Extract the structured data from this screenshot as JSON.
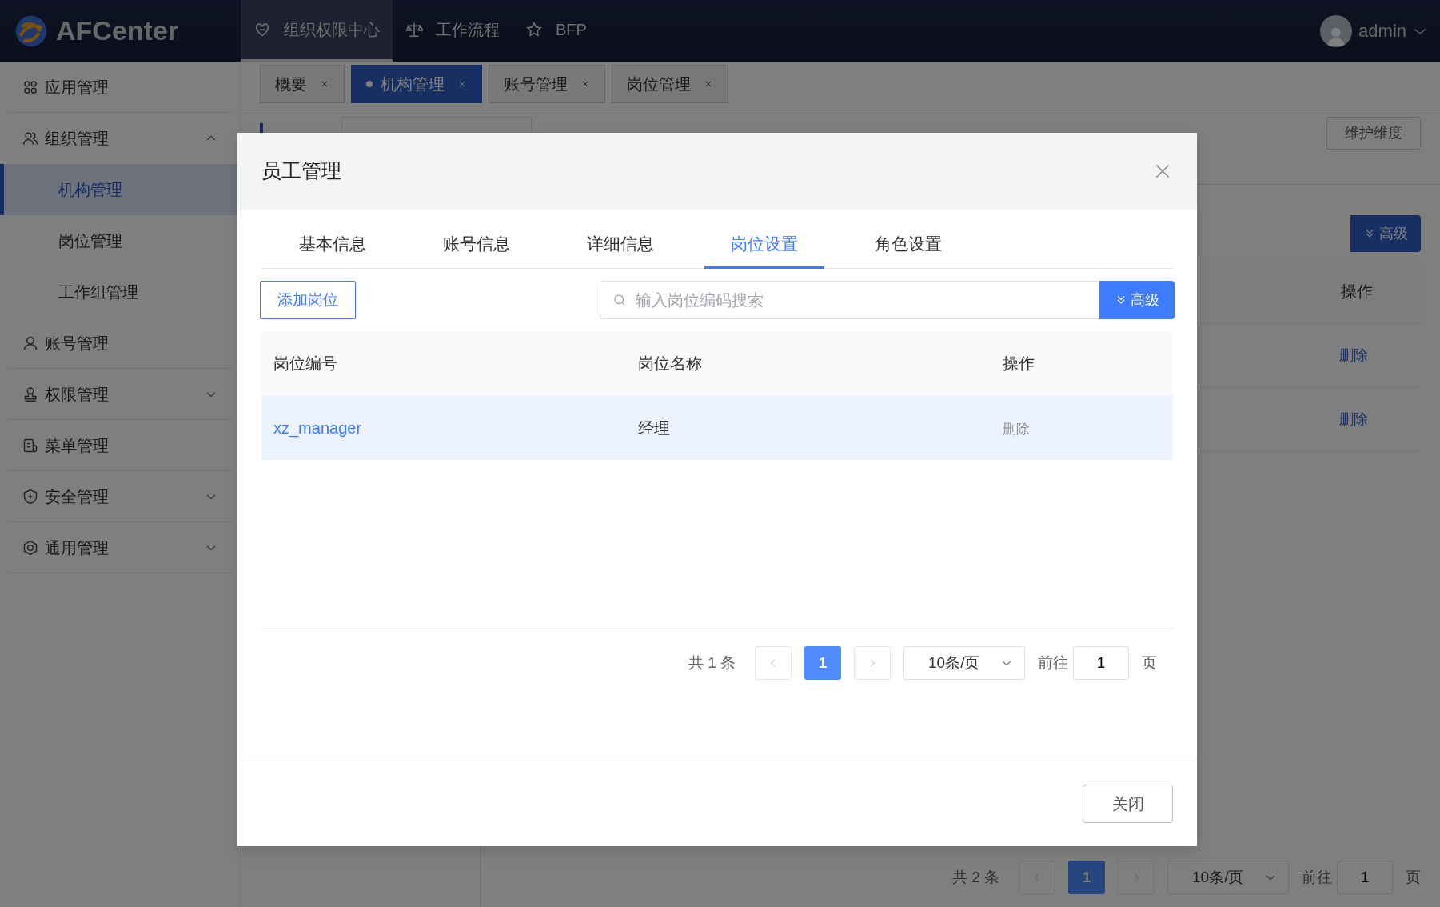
{
  "header": {
    "logo_text": "AFCenter",
    "nav": [
      {
        "label": "组织权限中心",
        "selected": true
      },
      {
        "label": "工作流程",
        "selected": false
      },
      {
        "label": "BFP",
        "selected": false
      }
    ],
    "user": "admin"
  },
  "sidebar": {
    "items": [
      {
        "label": "应用管理",
        "kind": "item"
      },
      {
        "label": "组织管理",
        "kind": "group",
        "expanded": true,
        "children": [
          {
            "label": "机构管理",
            "selected": true
          },
          {
            "label": "岗位管理",
            "selected": false
          },
          {
            "label": "工作组管理",
            "selected": false
          }
        ]
      },
      {
        "label": "账号管理",
        "kind": "item"
      },
      {
        "label": "权限管理",
        "kind": "group",
        "expanded": false
      },
      {
        "label": "菜单管理",
        "kind": "item"
      },
      {
        "label": "安全管理",
        "kind": "group",
        "expanded": false
      },
      {
        "label": "通用管理",
        "kind": "group",
        "expanded": false
      }
    ]
  },
  "page_tabs": [
    {
      "label": "概要",
      "selected": false
    },
    {
      "label": "机构管理",
      "selected": true
    },
    {
      "label": "账号管理",
      "selected": false
    },
    {
      "label": "岗位管理",
      "selected": false
    }
  ],
  "background": {
    "maintain_button": "维护维度",
    "advanced_button": "高级",
    "action_header": "操作",
    "row_actions": [
      "删除",
      "删除"
    ],
    "pagination": {
      "total": "共 2 条",
      "page": "1",
      "page_size": "10条/页",
      "goto_label": "前往",
      "goto_value": "1",
      "page_unit": "页"
    }
  },
  "modal": {
    "title": "员工管理",
    "tabs": [
      {
        "label": "基本信息",
        "selected": false
      },
      {
        "label": "账号信息",
        "selected": false
      },
      {
        "label": "详细信息",
        "selected": false
      },
      {
        "label": "岗位设置",
        "selected": true
      },
      {
        "label": "角色设置",
        "selected": false
      }
    ],
    "add_button": "添加岗位",
    "search": {
      "placeholder": "输入岗位编码搜索"
    },
    "advanced_button": "高级",
    "table": {
      "columns": [
        "岗位编号",
        "岗位名称",
        "操作"
      ],
      "rows": [
        {
          "code": "xz_manager",
          "name": "经理",
          "action": "删除",
          "action_disabled": true,
          "selected": true
        }
      ]
    },
    "pagination": {
      "total": "共 1 条",
      "page": "1",
      "page_size": "10条/页",
      "goto_label": "前往",
      "goto_value": "1",
      "page_unit": "页"
    },
    "close_button": "关闭"
  }
}
